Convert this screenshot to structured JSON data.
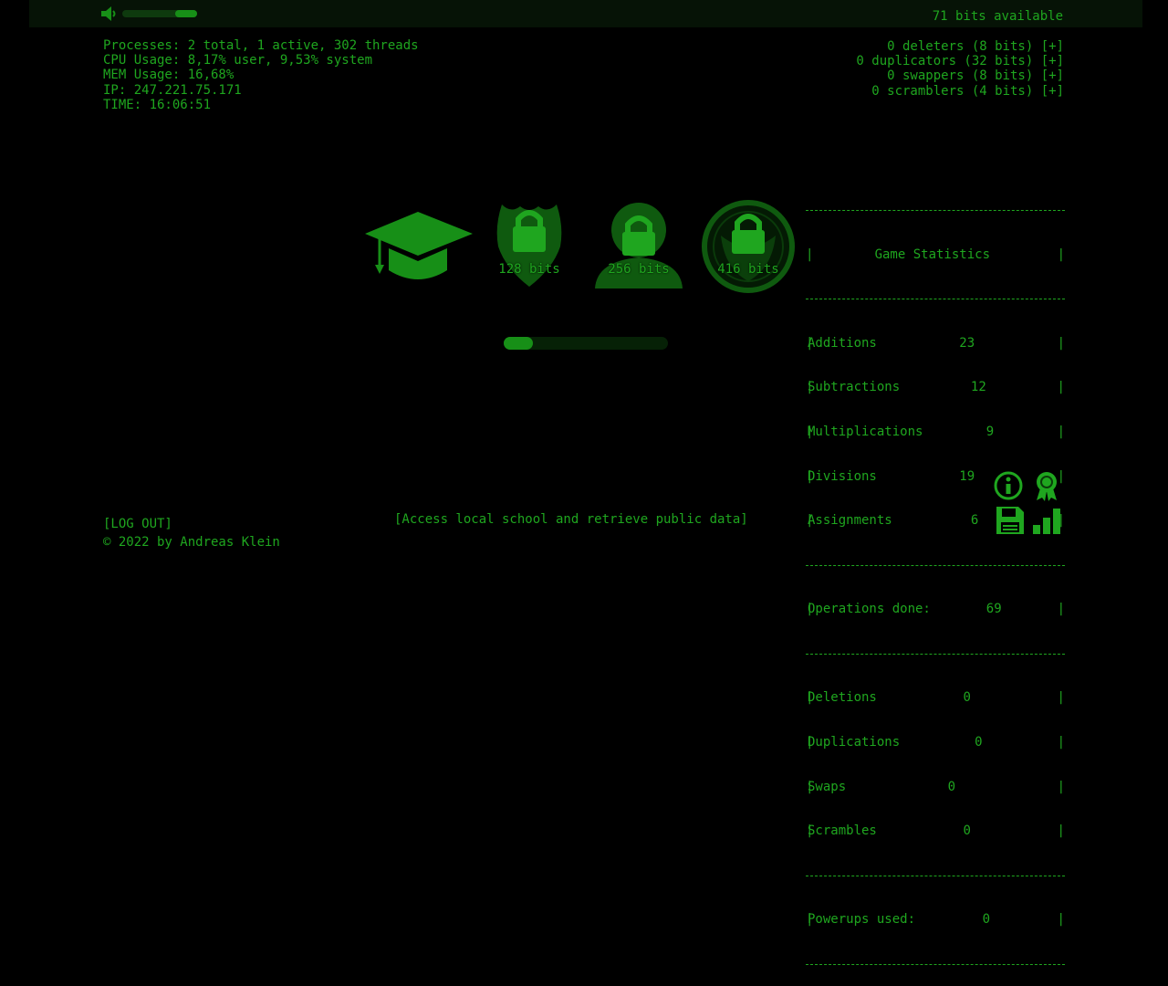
{
  "top": {
    "bits_available": "71 bits available",
    "volume_level": 0.3
  },
  "system": {
    "processes": "Processes: 2 total, 1 active, 302 threads",
    "cpu": "CPU Usage: 8,17% user, 9,53% system",
    "mem": "MEM Usage: 16,68%",
    "ip": "IP: 247.221.75.171",
    "time": "TIME: 16:06:51"
  },
  "powerups": [
    "0 deleters (8 bits) [+]",
    "0 duplicators (32 bits) [+]",
    "0 swappers (8 bits) [+]",
    "0 scramblers (4 bits) [+]"
  ],
  "targets": [
    {
      "icon": "graduation-cap-icon",
      "label": ""
    },
    {
      "icon": "police-badge-lock-icon",
      "label": "128 bits"
    },
    {
      "icon": "person-lock-icon",
      "label": "256 bits"
    },
    {
      "icon": "eagle-seal-lock-icon",
      "label": "416 bits"
    }
  ],
  "progress": {
    "fraction": 0.18
  },
  "stats": {
    "title": "Game Statistics",
    "rows1": [
      {
        "label": "Additions",
        "value": "23"
      },
      {
        "label": "Subtractions",
        "value": "12"
      },
      {
        "label": "Multiplications",
        "value": "9"
      },
      {
        "label": "Divisions",
        "value": "19"
      },
      {
        "label": "Assignments",
        "value": "6"
      }
    ],
    "operations": {
      "label": "Operations done:",
      "value": "69"
    },
    "rows2": [
      {
        "label": "Deletions",
        "value": "0"
      },
      {
        "label": "Duplications",
        "value": "0"
      },
      {
        "label": "Swaps",
        "value": "0"
      },
      {
        "label": "Scrambles",
        "value": "0"
      }
    ],
    "powerups_used": {
      "label": "Powerups used:",
      "value": "0"
    }
  },
  "mission": "[Access local school and retrieve public data]",
  "footer": {
    "logout": "[LOG OUT]",
    "copyright": "© 2022 by Andreas Klein"
  },
  "colors": {
    "primary": "#1fa61f",
    "background": "#000000",
    "dim": "#0e3a0e"
  }
}
